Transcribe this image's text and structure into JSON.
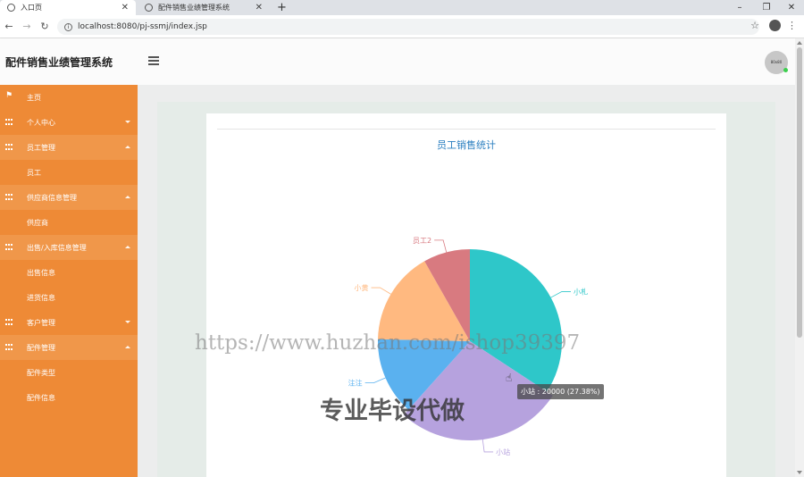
{
  "browser": {
    "tabs": [
      {
        "label": "入口页",
        "active": true
      },
      {
        "label": "配件销售业绩管理系统",
        "active": false
      }
    ],
    "new_tab": "+",
    "url": "localhost:8080/pj-ssmj/index.jsp",
    "win_min": "–",
    "win_max": "❐",
    "win_close": "✕"
  },
  "app": {
    "title": "配件销售业绩管理系统",
    "avatar_text": "80x80"
  },
  "sidebar": {
    "items": [
      {
        "label": "主页",
        "type": "flag"
      },
      {
        "label": "个人中心",
        "type": "parent",
        "open": false
      },
      {
        "label": "员工管理",
        "type": "parent",
        "open": true
      },
      {
        "label": "员工",
        "type": "sub"
      },
      {
        "label": "供应商信息管理",
        "type": "parent",
        "open": true
      },
      {
        "label": "供应商",
        "type": "sub"
      },
      {
        "label": "出售/入库信息管理",
        "type": "parent",
        "open": true
      },
      {
        "label": "出售信息",
        "type": "sub"
      },
      {
        "label": "进货信息",
        "type": "sub"
      },
      {
        "label": "客户管理",
        "type": "parent",
        "open": false
      },
      {
        "label": "配件管理",
        "type": "parent",
        "open": true
      },
      {
        "label": "配件类型",
        "type": "sub"
      },
      {
        "label": "配件信息",
        "type": "sub"
      }
    ]
  },
  "chart_data": {
    "type": "pie",
    "title": "员工销售统计",
    "series": [
      {
        "name": "小札",
        "value": 25000,
        "color": "#2ec7c9"
      },
      {
        "name": "小站",
        "value": 20000,
        "color": "#b6a2de"
      },
      {
        "name": "注注",
        "value": 10000,
        "color": "#5ab1ef"
      },
      {
        "name": "小黄",
        "value": 12000,
        "color": "#ffb980"
      },
      {
        "name": "员工2",
        "value": 6000,
        "color": "#d87a80"
      }
    ]
  },
  "tooltip": {
    "text": "小站 : 20000 (27.38%)"
  },
  "watermarks": {
    "url": "https://www.huzhan.com/ishop39397",
    "text": "专业毕设代做"
  }
}
